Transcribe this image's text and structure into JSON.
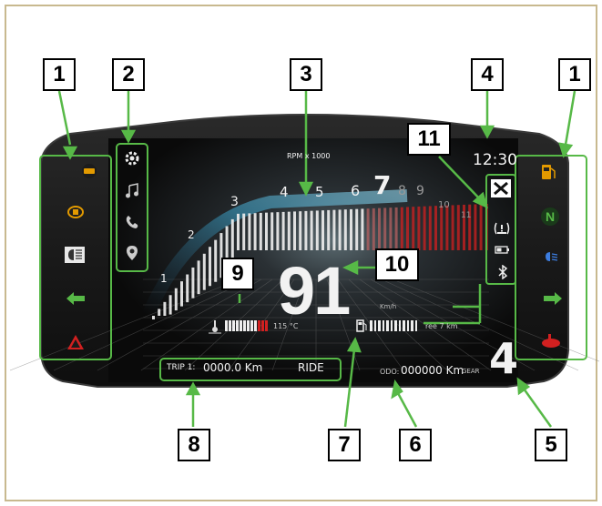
{
  "callouts": {
    "left_indicators": "1",
    "menu": "2",
    "tachometer": "3",
    "clock": "4",
    "gear": "5",
    "odometer": "6",
    "fuel": "7",
    "trip": "8",
    "coolant": "9",
    "speed": "10",
    "warnings": "11",
    "right_indicators": "1"
  },
  "dash": {
    "rpm_label": "RPM x 1000",
    "rpm_ticks": [
      "1",
      "2",
      "3",
      "4",
      "5",
      "6",
      "7",
      "8",
      "9",
      "10",
      "11"
    ],
    "clock": "12:30",
    "speed": "91",
    "speed_unit": "Km/h",
    "coolant_temp": "115 °C",
    "fuel_range": "ree 7 km",
    "trip_label": "TRIP 1:",
    "trip_value": "0000.0 Km",
    "ride_mode": "RIDE",
    "odo_label": "ODO:",
    "odo_value": "000000 Km",
    "gear_label": "GEAR",
    "gear_value": "4"
  },
  "menu_icons": [
    "gear-icon",
    "music-icon",
    "phone-icon",
    "location-icon"
  ],
  "left_warning_icons": [
    "engine-icon",
    "oil-icon",
    "high-beam-icon",
    "left-turn-icon",
    "hazard-icon"
  ],
  "right_warning_icons": [
    "fuel-icon",
    "neutral-icon",
    "low-beam-icon",
    "right-turn-icon",
    "oil-temp-icon"
  ],
  "status_icons": [
    "tool-icon",
    "tire-pressure-icon",
    "battery-icon",
    "bluetooth-icon"
  ],
  "colors": {
    "annotation_green": "#57b947",
    "frame": "#c8b98f",
    "redline": "#d22020",
    "shift_light": "#ff9a00"
  }
}
